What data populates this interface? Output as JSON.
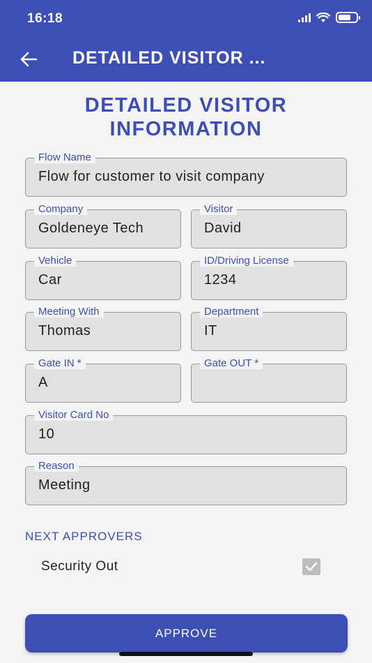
{
  "status_bar": {
    "time": "16:18",
    "battery_level": 0.7
  },
  "app_bar": {
    "title": "DETAILED VISITOR ..."
  },
  "heading": {
    "line1": "DETAILED VISITOR",
    "line2": "INFORMATION"
  },
  "fields": {
    "flow_name": {
      "label": "Flow Name",
      "value": "Flow for customer to visit company"
    },
    "company": {
      "label": "Company",
      "value": "Goldeneye Tech"
    },
    "visitor": {
      "label": "Visitor",
      "value": "David"
    },
    "vehicle": {
      "label": "Vehicle",
      "value": "Car"
    },
    "id_license": {
      "label": "ID/Driving License",
      "value": "1234"
    },
    "meeting_with": {
      "label": "Meeting With",
      "value": "Thomas"
    },
    "department": {
      "label": "Department",
      "value": "IT"
    },
    "gate_in": {
      "label": "Gate IN",
      "required_mark": "*",
      "value": "A"
    },
    "gate_out": {
      "label": "Gate OUT",
      "required_mark": "*",
      "value": ""
    },
    "visitor_card_no": {
      "label": "Visitor Card No",
      "value": "10"
    },
    "reason": {
      "label": "Reason",
      "value": "Meeting"
    }
  },
  "next_approvers": {
    "title": "NEXT APPROVERS",
    "items": [
      {
        "label": "Security Out",
        "checked": true
      }
    ]
  },
  "approve_button": {
    "label": "APPROVE"
  },
  "colors": {
    "primary": "#3d4fb5",
    "field_bg": "#e1e1e1",
    "page_bg": "#f4f4f4"
  }
}
